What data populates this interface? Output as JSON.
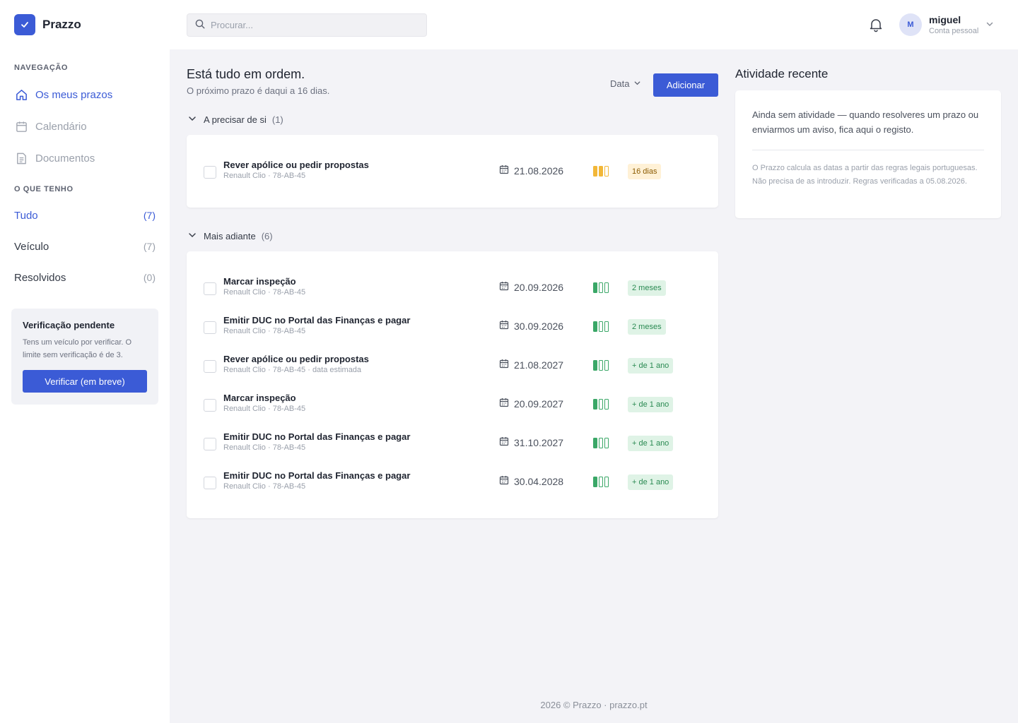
{
  "brand": {
    "name": "Prazzo",
    "logo_icon": "check-icon"
  },
  "sidebar": {
    "nav_heading": "NAVEGAÇÃO",
    "nav": [
      {
        "label": "Os meus prazos",
        "icon": "home-icon",
        "active": true
      },
      {
        "label": "Calendário",
        "icon": "calendar-icon",
        "active": false
      },
      {
        "label": "Documentos",
        "icon": "document-icon",
        "active": false
      }
    ],
    "filters_heading": "O QUE TENHO",
    "filters": [
      {
        "label": "Tudo",
        "count": "(7)",
        "active": true
      },
      {
        "label": "Veículo",
        "count": "(7)",
        "active": false
      },
      {
        "label": "Resolvidos",
        "count": "(0)",
        "active": false
      }
    ],
    "verify": {
      "title": "Verificação pendente",
      "text": "Tens um veículo por verificar. O limite sem verificação é de 3.",
      "button": "Verificar (em breve)"
    }
  },
  "topbar": {
    "search_placeholder": "Procurar...",
    "user": {
      "initial": "M",
      "name": "miguel",
      "subtitle": "Conta pessoal"
    }
  },
  "main": {
    "title": "Está tudo em ordem.",
    "subtitle": "O próximo prazo é daqui a 16 dias.",
    "sort_label": "Data",
    "add_button": "Adicionar",
    "groups": [
      {
        "title": "A precisar de si",
        "count": "(1)",
        "items": [
          {
            "title": "Rever apólice ou pedir propostas",
            "subtitle": "Renault Clio · 78-AB-45",
            "date": "21.08.2026",
            "urgency": 3,
            "badge": "16 dias",
            "badge_type": "warn"
          }
        ]
      },
      {
        "title": "Mais adiante",
        "count": "(6)",
        "items": [
          {
            "title": "Marcar inspeção",
            "subtitle": "Renault Clio · 78-AB-45",
            "date": "20.09.2026",
            "urgency": 1,
            "badge": "2 meses",
            "badge_type": "ok"
          },
          {
            "title": "Emitir DUC no Portal das Finanças e pagar",
            "subtitle": "Renault Clio · 78-AB-45",
            "date": "30.09.2026",
            "urgency": 1,
            "badge": "2 meses",
            "badge_type": "ok"
          },
          {
            "title": "Rever apólice ou pedir propostas",
            "subtitle": "Renault Clio · 78-AB-45 · data estimada",
            "date": "21.08.2027",
            "urgency": 1,
            "badge": "+ de 1 ano",
            "badge_type": "ok"
          },
          {
            "title": "Marcar inspeção",
            "subtitle": "Renault Clio · 78-AB-45",
            "date": "20.09.2027",
            "urgency": 1,
            "badge": "+ de 1 ano",
            "badge_type": "ok"
          },
          {
            "title": "Emitir DUC no Portal das Finanças e pagar",
            "subtitle": "Renault Clio · 78-AB-45",
            "date": "31.10.2027",
            "urgency": 1,
            "badge": "+ de 1 ano",
            "badge_type": "ok"
          },
          {
            "title": "Emitir DUC no Portal das Finanças e pagar",
            "subtitle": "Renault Clio · 78-AB-45",
            "date": "30.04.2028",
            "urgency": 1,
            "badge": "+ de 1 ano",
            "badge_type": "ok"
          }
        ]
      }
    ]
  },
  "activity": {
    "title": "Atividade recente",
    "text": "Ainda sem atividade — quando resolveres um prazo ou enviarmos um aviso, fica aqui o registo.",
    "note": "O Prazzo calcula as datas a partir das regras legais portuguesas. Não precisa de as introduzir. Regras verificadas a 05.08.2026."
  },
  "footer": "2026 © Prazzo · prazzo.pt",
  "colors": {
    "accent": "#3b5bd6",
    "warn": "#f2b738",
    "ok": "#3aa767"
  }
}
